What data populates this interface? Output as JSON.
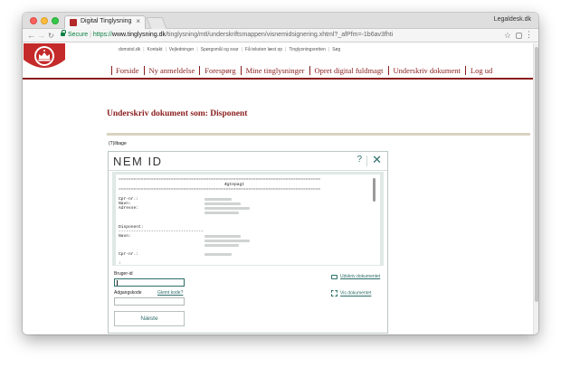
{
  "browser": {
    "tab_title": "Digital Tinglysning",
    "tab_close": "×",
    "profile_name": "Legaldesk.dk",
    "url_secure_label": "Secure",
    "url_scheme": "https://",
    "url_host": "www.tinglysning.dk",
    "url_path": "/tinglysning/mtl/underskriftsmappen/visnemidsignering.xhtml?_afPfm=-1b6av3fhti",
    "colors": {
      "secure": "#0b8043"
    }
  },
  "site": {
    "logo_icon": "crown-seal-logo",
    "top_links": [
      "domstol.dk",
      "Kontakt",
      "Vejledninger",
      "Spørgsmål og svar",
      "Få teksten læst op",
      "Tinglysningsretten",
      "Søg"
    ],
    "nav": [
      "Forside",
      "Ny anmeldelse",
      "Forespørg",
      "Mine tinglysninger",
      "Opret digital fuldmagt",
      "Underskriv dokument",
      "Log ud"
    ],
    "heading": "Underskriv dokument som: Disponent",
    "back_link": "(T)ilbage",
    "colors": {
      "brand": "#8a1c1c"
    }
  },
  "nemid": {
    "logo": "NEM ID",
    "help": "?",
    "close": "✕",
    "document": {
      "rule_top": "=================================================================================",
      "title": "Ægtepagt",
      "rule_bottom": "=================================================================================",
      "cpr_label": "Cpr-nr.:",
      "navn_label": "Navn:",
      "adresse_label": "Adresse:",
      "disponent_label": "Disponent:",
      "disponent_rule": "----------------------------------",
      "navn2_label": "Navn:",
      "cpr2_label": "Cpr-nr.:",
      "cut_label": ":"
    },
    "user_id_label": "Bruger-id",
    "password_label": "Adgangskode",
    "forgot_link": "Glemt kode?",
    "next_button": "Næste",
    "print_link": "Udskriv dokumentet",
    "show_link": "Vis dokumentet",
    "colors": {
      "accent": "#2e6e6a"
    }
  }
}
